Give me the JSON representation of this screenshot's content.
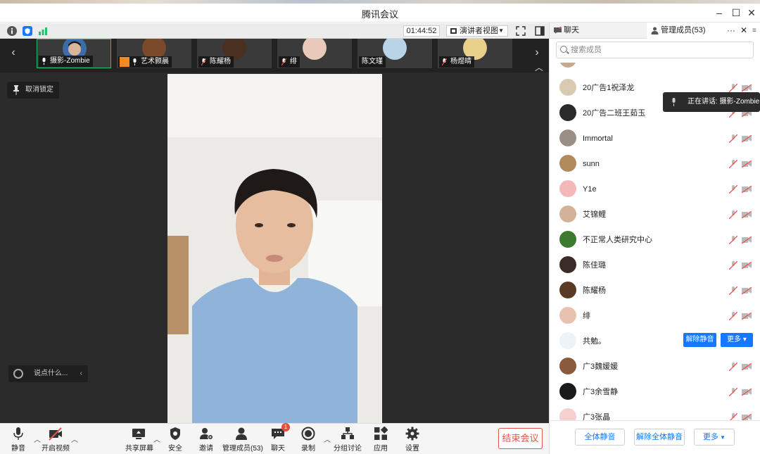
{
  "window": {
    "title": "腾讯会议"
  },
  "statusbar": {
    "timer": "01:44:52",
    "view_label": "演讲者视图"
  },
  "thumbs": [
    {
      "name": "摄影-Zombie",
      "active": true
    },
    {
      "name": "艺术颢晨"
    },
    {
      "name": "陈耀杨"
    },
    {
      "name": "绯"
    },
    {
      "name": "陈文瑾"
    },
    {
      "name": "杨煜晴"
    }
  ],
  "video": {
    "unpin_label": "取消锁定",
    "chat_placeholder": "说点什么..."
  },
  "toolbar": {
    "mute": "静音",
    "video": "开启视频",
    "share": "共享屏幕",
    "security": "安全",
    "invite": "邀请",
    "manage": "管理成员(53)",
    "chat": "聊天",
    "chat_badge": "1",
    "record": "录制",
    "breakout": "分组讨论",
    "apps": "应用",
    "settings": "设置",
    "end": "结束会议"
  },
  "panel": {
    "tab_chat": "聊天",
    "tab_members": "管理成员(53)",
    "search_placeholder": "搜索成员",
    "speaking": "正在讲话: 摄影-Zombie",
    "members": [
      {
        "name": "20广告1祝泽龙"
      },
      {
        "name": "20广告二班王茹玉"
      },
      {
        "name": "Immortal"
      },
      {
        "name": "sunn"
      },
      {
        "name": "Y1e"
      },
      {
        "name": "艾锦鲤"
      },
      {
        "name": "不正常人类研究中心"
      },
      {
        "name": "陈佳璐"
      },
      {
        "name": "陈耀杨"
      },
      {
        "name": "绯"
      },
      {
        "name": "共勉。"
      },
      {
        "name": "广3魏媛媛"
      },
      {
        "name": "广3余雪静"
      },
      {
        "name": "广3张晶"
      }
    ],
    "unmute_label": "解除静音",
    "more_label": "更多",
    "footer": {
      "mute_all": "全体静音",
      "unmute_all": "解除全体静音",
      "more": "更多"
    }
  },
  "colors": {
    "accent": "#1677ff",
    "danger": "#e5534b",
    "green": "#23c16b"
  }
}
